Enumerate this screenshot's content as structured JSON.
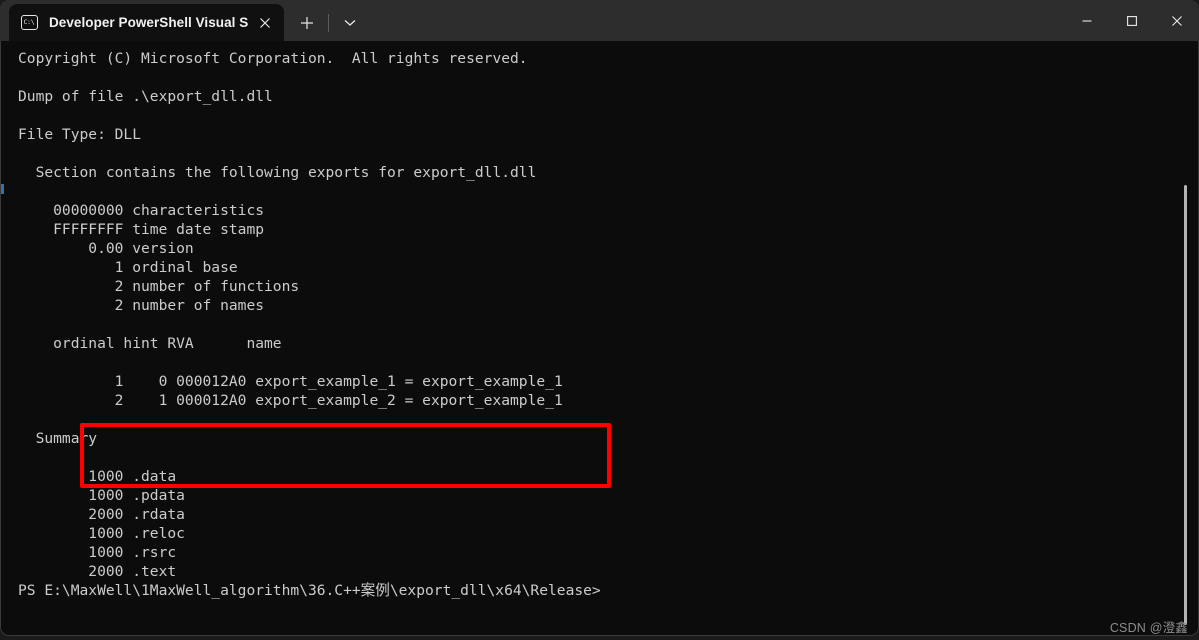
{
  "window": {
    "title_bar": {
      "tab": {
        "icon": "console-prompt-icon",
        "icon_text": "C:\\",
        "label": "Developer PowerShell Visual S",
        "close_icon": "close-icon"
      },
      "new_tab_icon": "plus-icon",
      "tab_dropdown_icon": "chevron-down-icon",
      "controls": {
        "minimize_icon": "minimize-icon",
        "maximize_icon": "maximize-icon",
        "close_icon": "close-icon"
      }
    }
  },
  "terminal": {
    "colors": {
      "background": "#0c0c0c",
      "foreground": "#cccccc",
      "titlebar": "#2d2d2d",
      "active_tab": "#101010",
      "annotation": "#fe0000",
      "scrollbar_thumb": "#b4b4b4",
      "gutter_mark": "#3b6ea8"
    },
    "lines": [
      "Copyright (C) Microsoft Corporation.  All rights reserved.",
      "",
      "Dump of file .\\export_dll.dll",
      "",
      "File Type: DLL",
      "",
      "  Section contains the following exports for export_dll.dll",
      "",
      "    00000000 characteristics",
      "    FFFFFFFF time date stamp",
      "        0.00 version",
      "           1 ordinal base",
      "           2 number of functions",
      "           2 number of names",
      "",
      "    ordinal hint RVA      name",
      "",
      "           1    0 000012A0 export_example_1 = export_example_1",
      "           2    1 000012A0 export_example_2 = export_example_1",
      "",
      "  Summary",
      "",
      "        1000 .data",
      "        1000 .pdata",
      "        2000 .rdata",
      "        1000 .reloc",
      "        1000 .rsrc",
      "        2000 .text"
    ],
    "prompt_line": "PS E:\\MaxWell\\1MaxWell_algorithm\\36.C++案例\\export_dll\\x64\\Release>",
    "dumpbin_exports": {
      "headers": [
        "ordinal",
        "hint",
        "RVA",
        "name"
      ],
      "rows": [
        [
          "1",
          "0",
          "000012A0",
          "export_example_1 = export_example_1"
        ],
        [
          "2",
          "1",
          "000012A0",
          "export_example_2 = export_example_1"
        ]
      ]
    },
    "export_header_fields": {
      "characteristics": "00000000",
      "time_date_stamp": "FFFFFFFF",
      "version": "0.00",
      "ordinal_base": "1",
      "number_of_functions": "2",
      "number_of_names": "2"
    },
    "summary_sections": [
      {
        "size": "1000",
        "name": ".data"
      },
      {
        "size": "1000",
        "name": ".pdata"
      },
      {
        "size": "2000",
        "name": ".rdata"
      },
      {
        "size": "1000",
        "name": ".reloc"
      },
      {
        "size": "1000",
        "name": ".rsrc"
      },
      {
        "size": "2000",
        "name": ".text"
      }
    ],
    "file": {
      "dump_of_file": ".\\export_dll.dll",
      "file_type": "DLL"
    }
  },
  "watermark": {
    "text": "CSDN @澄鑫"
  }
}
